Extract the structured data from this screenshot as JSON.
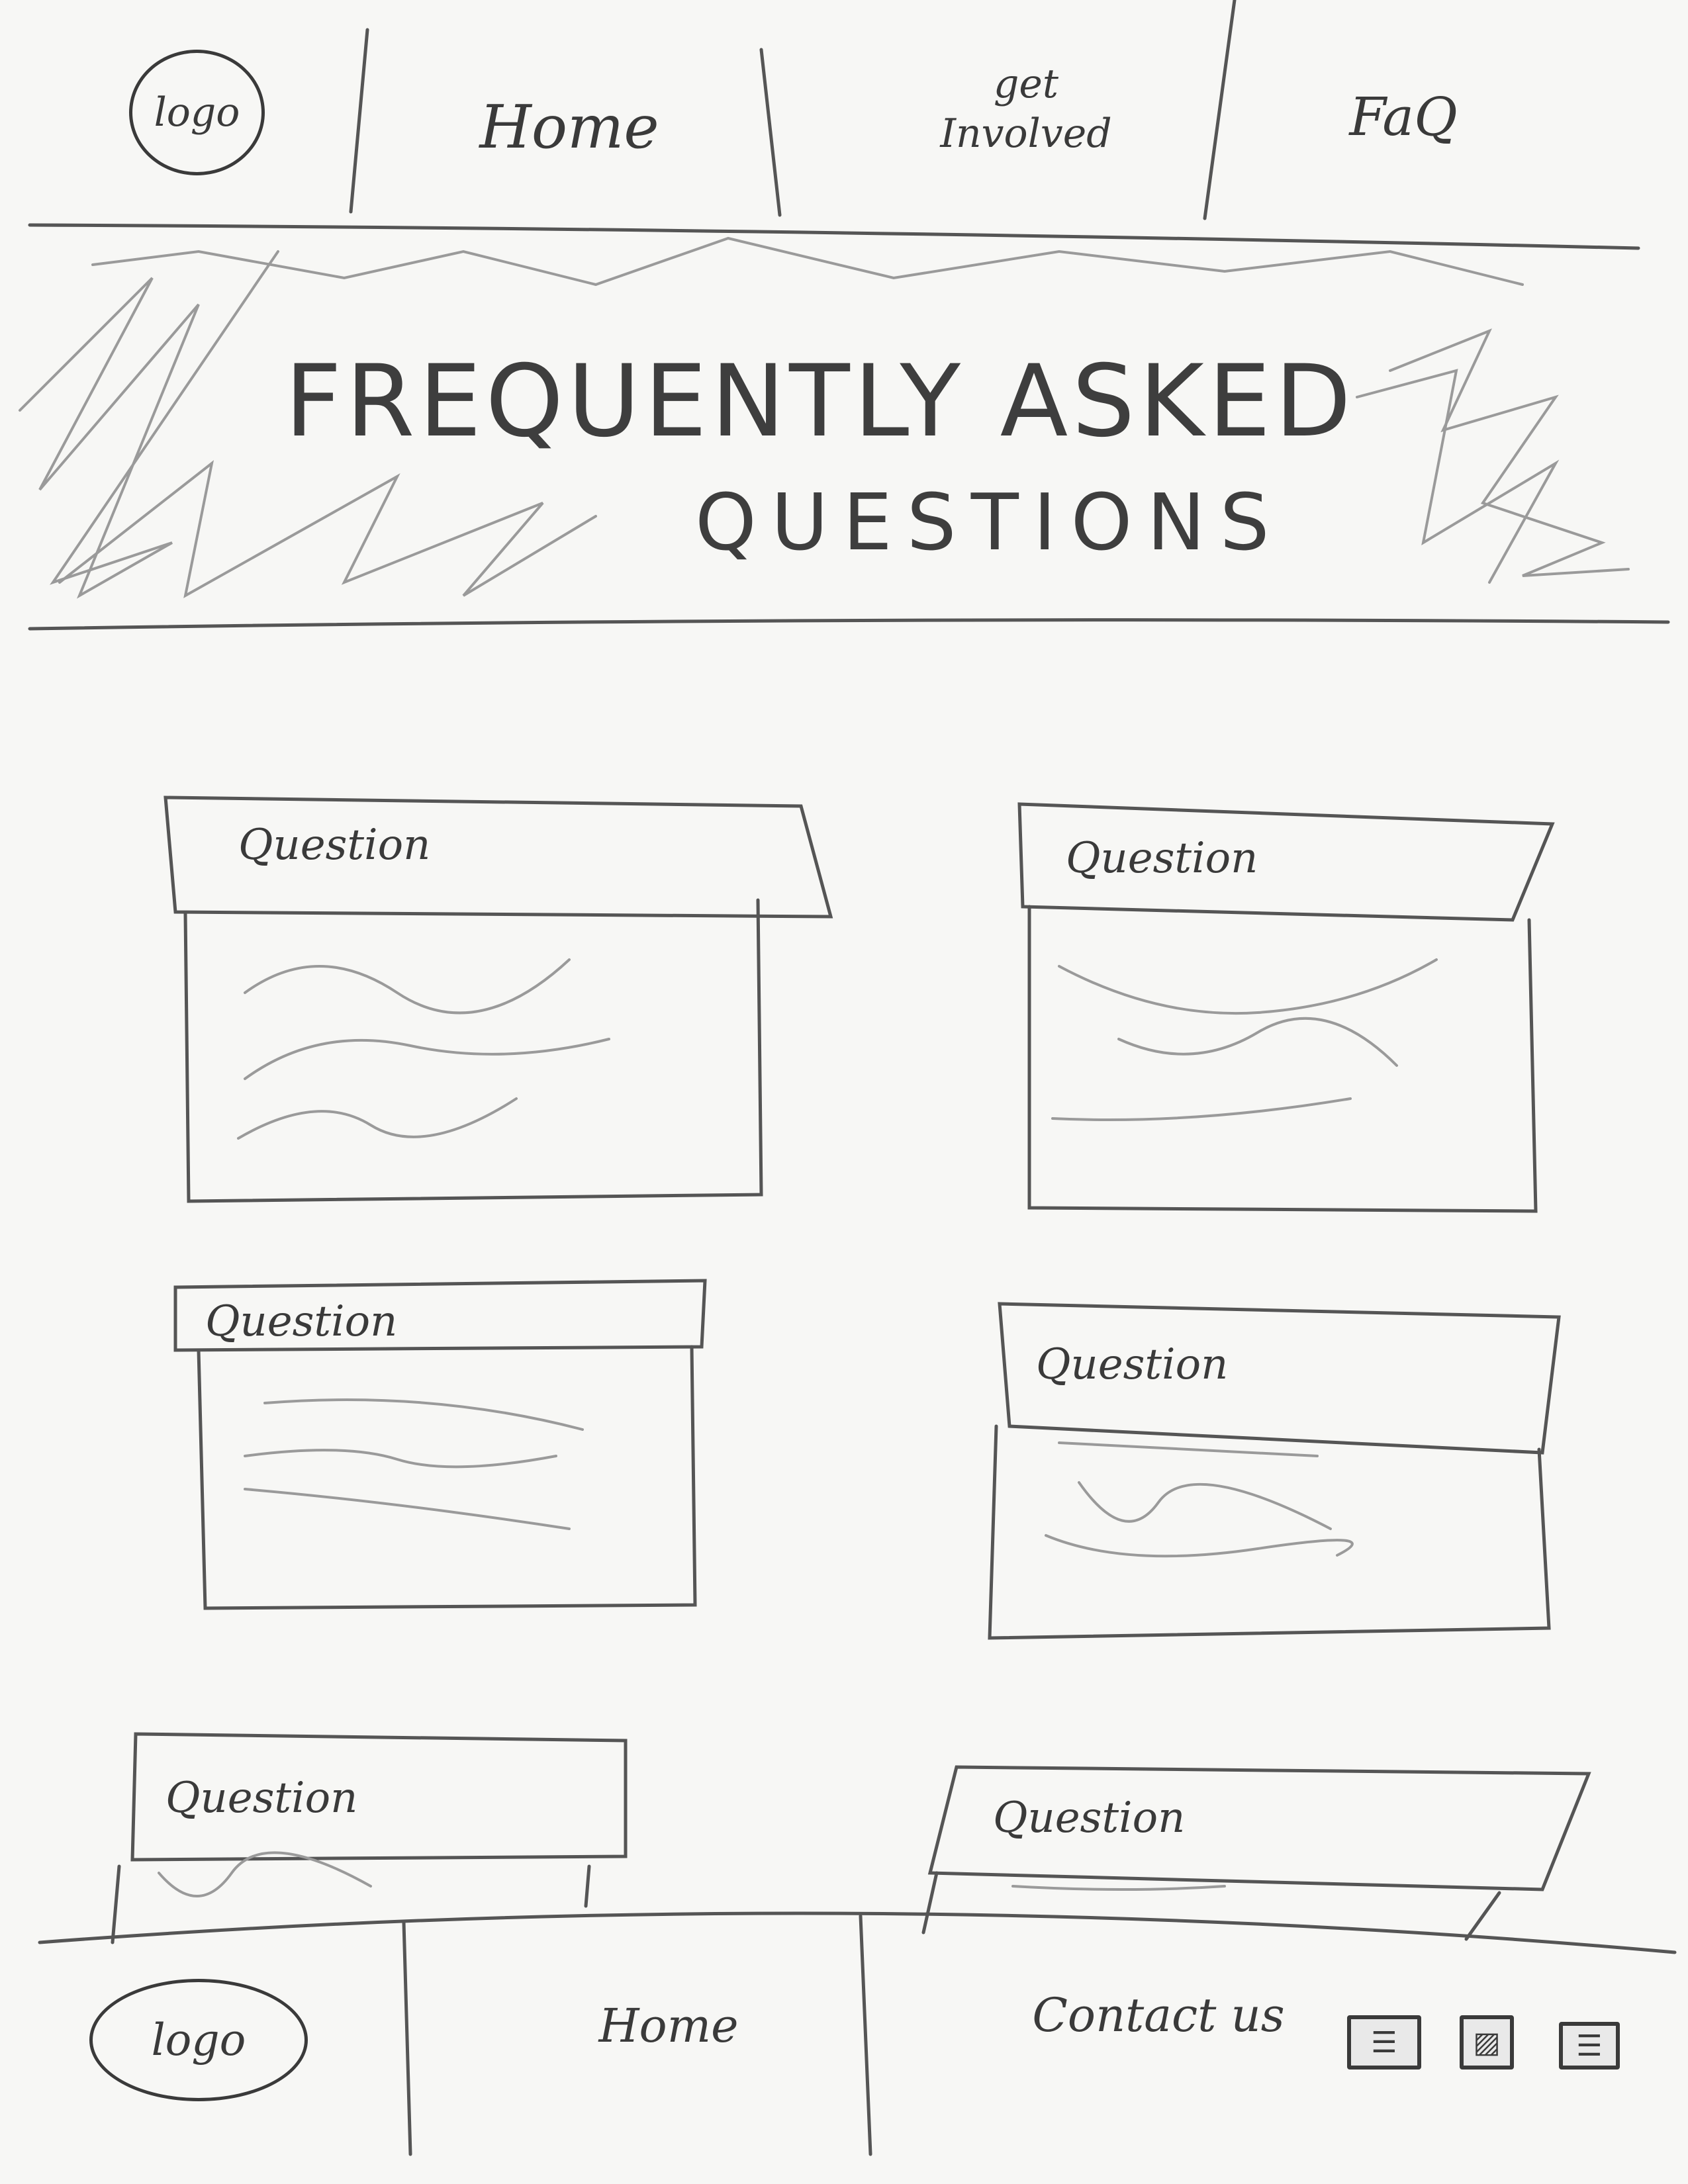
{
  "header": {
    "logo": "logo",
    "nav": [
      {
        "label": "Home"
      },
      {
        "label": "get Involved"
      },
      {
        "label": "FaQ"
      }
    ]
  },
  "banner": {
    "title_line1": "FREQUENTLY ASKED",
    "title_line2": "QUESTIONS"
  },
  "faq": [
    {
      "question": "Question"
    },
    {
      "question": "Question"
    },
    {
      "question": "Question"
    },
    {
      "question": "Question"
    },
    {
      "question": "Question"
    },
    {
      "question": "Question"
    }
  ],
  "footer": {
    "logo": "logo",
    "home": "Home",
    "contact": "Contact us",
    "social_icons": [
      "social-icon-1",
      "social-icon-2",
      "social-icon-3"
    ]
  }
}
